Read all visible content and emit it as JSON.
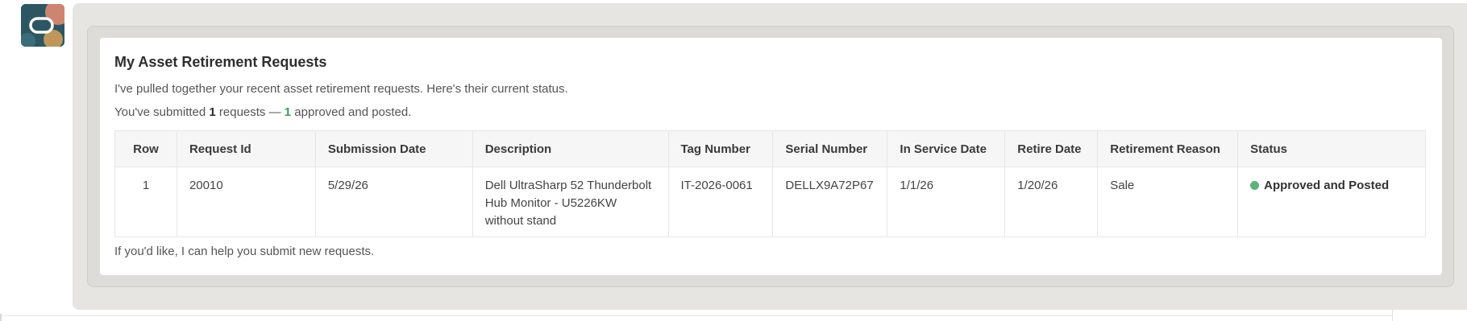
{
  "avatar": {
    "icon": "assistant-logo-icon"
  },
  "card": {
    "title": "My Asset Retirement Requests",
    "intro": "I've pulled together your recent asset retirement requests. Here's their current status.",
    "summary": {
      "prefix": "You've submitted ",
      "submitted_count": "1",
      "middle": " requests — ",
      "approved_count": "1",
      "suffix": " approved and posted."
    },
    "footer": "If you'd like, I can help you submit new requests."
  },
  "table": {
    "headers": [
      "Row",
      "Request Id",
      "Submission Date",
      "Description",
      "Tag Number",
      "Serial Number",
      "In Service Date",
      "Retire Date",
      "Retirement Reason",
      "Status"
    ],
    "rows": [
      {
        "row": "1",
        "request_id": "20010",
        "submission_date": "5/29/26",
        "description": "Dell UltraSharp 52 Thunderbolt Hub Monitor - U5226KW without stand",
        "tag_number": "IT-2026-0061",
        "serial_number": "DELLX9A72P67",
        "in_service_date": "1/1/26",
        "retire_date": "1/20/26",
        "retirement_reason": "Sale",
        "status": "Approved and Posted"
      }
    ]
  },
  "colors": {
    "status_approved": "#5cb37a",
    "approved_count": "#3d9a5a",
    "outer_background": "#e6e5e2"
  }
}
